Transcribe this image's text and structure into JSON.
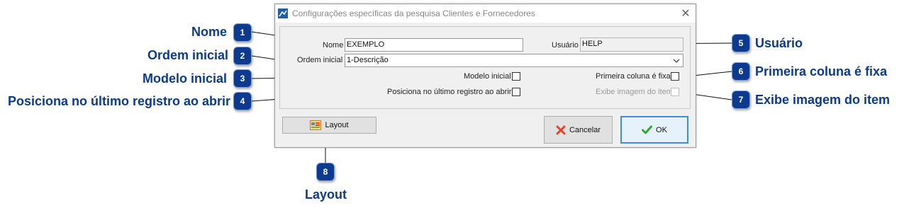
{
  "dialog": {
    "title": "Configurações específicas da pesquisa Clientes e Fornecedores",
    "close_glyph": "✕",
    "fields": {
      "nome_label": "Nome",
      "nome_value": "EXEMPLO",
      "usuario_label": "Usuário",
      "usuario_value": "HELP",
      "ordem_label": "Ordem inicial",
      "ordem_value": "1-Descrição",
      "modelo_label": "Modelo inicial",
      "primeira_label": "Primeira coluna é fixa",
      "posiciona_label": "Posiciona no último registro ao abrir",
      "exibe_label": "Exibe imagem do item"
    },
    "buttons": {
      "layout": "Layout",
      "cancel": "Cancelar",
      "ok": "OK"
    }
  },
  "callouts": [
    {
      "number": "1",
      "text": "Nome"
    },
    {
      "number": "2",
      "text": "Ordem inicial"
    },
    {
      "number": "3",
      "text": "Modelo inicial"
    },
    {
      "number": "4",
      "text": "Posiciona no último registro ao abrir"
    },
    {
      "number": "5",
      "text": "Usuário"
    },
    {
      "number": "6",
      "text": "Primeira coluna é fixa"
    },
    {
      "number": "7",
      "text": "Exibe imagem do item"
    },
    {
      "number": "8",
      "text": "Layout"
    }
  ],
  "colors": {
    "callout": "#0d3a8c",
    "ok_border": "#3c8fd6",
    "cancel_icon": "#e0452b",
    "ok_icon": "#3aa335"
  }
}
